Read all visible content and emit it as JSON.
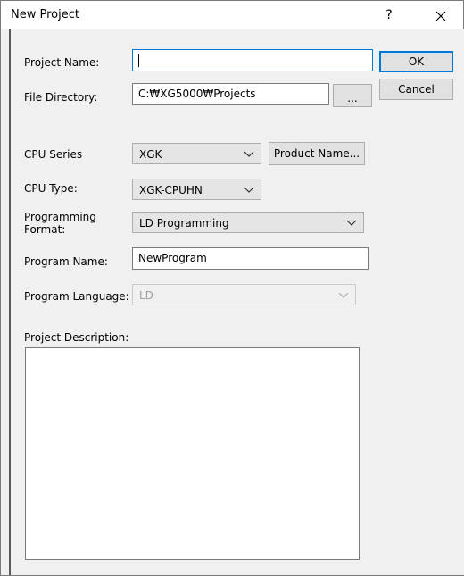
{
  "window": {
    "title": "New Project",
    "help_glyph": "?",
    "close_glyph": "✕"
  },
  "form": {
    "project_name_label": "Project Name:",
    "project_name_value": "",
    "file_directory_label": "File Directory:",
    "file_directory_value": "C:₩XG5000₩Projects",
    "browse_label": "...",
    "cpu_series_label": "CPU Series",
    "cpu_series_value": "XGK",
    "product_name_label": "Product Name...",
    "cpu_type_label": "CPU Type:",
    "cpu_type_value": "XGK-CPUHN",
    "programming_format_label_1": "Programming",
    "programming_format_label_2": "Format:",
    "programming_format_value": "LD Programming",
    "program_name_label": "Program Name:",
    "program_name_value": "NewProgram",
    "program_language_label": "Program Language:",
    "program_language_value": "LD",
    "project_description_label": "Project Description:",
    "project_description_value": ""
  },
  "buttons": {
    "ok_label": "OK",
    "cancel_label": "Cancel"
  },
  "icons": {
    "dropdown": "chevron-down-icon",
    "close": "close-icon",
    "help": "help-icon"
  },
  "colors": {
    "focus_border": "#0078d7",
    "dialog_bg": "#f0f0f0",
    "disabled_text": "#a0a0a0"
  }
}
